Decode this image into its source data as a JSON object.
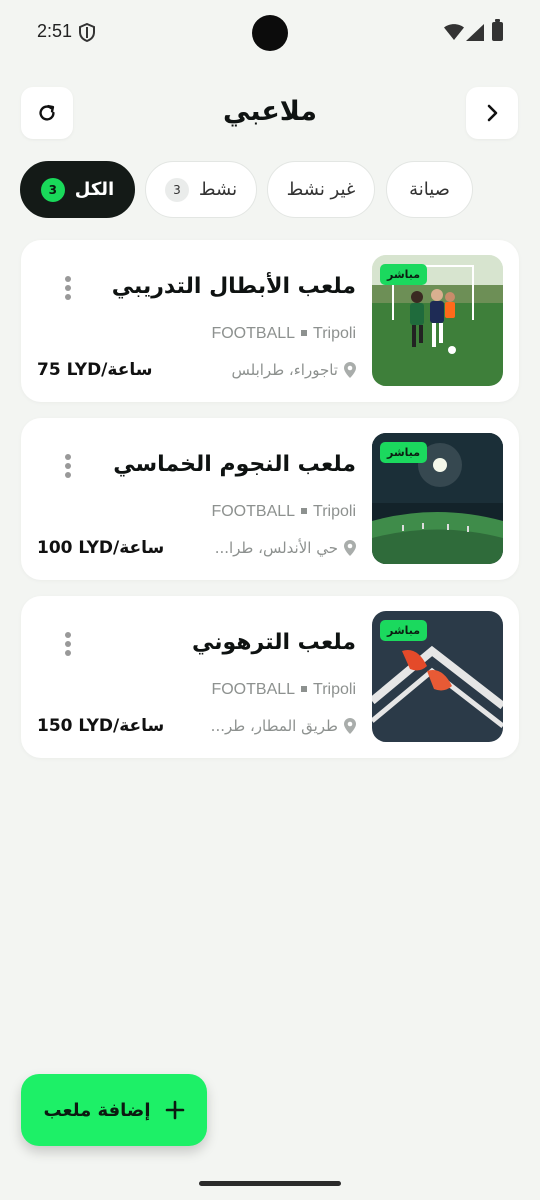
{
  "status_bar": {
    "time": "2:51"
  },
  "header": {
    "title": "ملاعبي"
  },
  "filters": [
    {
      "label": "صيانة"
    },
    {
      "label": "غير نشط"
    },
    {
      "label": "نشط",
      "count": "3"
    },
    {
      "label": "الكل",
      "count": "3",
      "selected": true
    }
  ],
  "venues": [
    {
      "name": "ملعب الأبطال التدريبي",
      "sport": "FOOTBALL",
      "city": "Tripoli",
      "location": "تاجوراء، طرابلس",
      "price": "75 LYD/ساعة",
      "badge": "مباشر"
    },
    {
      "name": "ملعب النجوم الخماسي",
      "sport": "FOOTBALL",
      "city": "Tripoli",
      "location": "حي الأندلس، طرا...",
      "price": "100 LYD/ساعة",
      "badge": "مباشر"
    },
    {
      "name": "ملعب الترهوني",
      "sport": "FOOTBALL",
      "city": "Tripoli",
      "location": "طريق المطار، طر...",
      "price": "150 LYD/ساعة",
      "badge": "مباشر"
    }
  ],
  "fab": {
    "label": "إضافة ملعب"
  },
  "colors": {
    "accent": "#1df067",
    "dark_chip": "#141a17",
    "background": "#f3f5f2"
  }
}
